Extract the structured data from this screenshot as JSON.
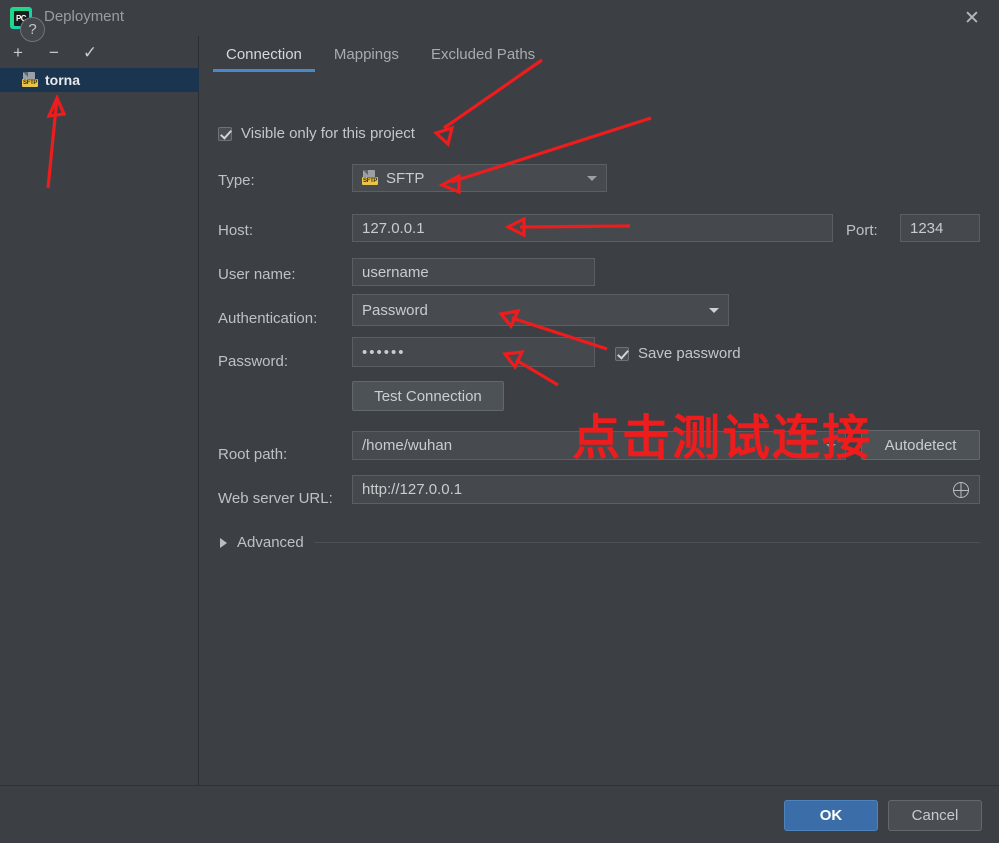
{
  "window": {
    "title": "Deployment",
    "logo_text": "PC",
    "close_label": "✕"
  },
  "sidebar": {
    "toolbar": [
      {
        "name": "add",
        "glyph": "+"
      },
      {
        "name": "remove",
        "glyph": "−"
      },
      {
        "name": "apply",
        "glyph": "✓"
      }
    ],
    "items": [
      {
        "label": "torna",
        "badge": "SFTP",
        "selected": true
      }
    ]
  },
  "tabs": [
    {
      "label": "Connection",
      "active": true
    },
    {
      "label": "Mappings",
      "active": false
    },
    {
      "label": "Excluded Paths",
      "active": false
    }
  ],
  "form": {
    "visible_only_label": "Visible only for this project",
    "type_label": "Type:",
    "type_value": "SFTP",
    "type_badge": "SFTP",
    "host_label": "Host:",
    "host_value": "127.0.0.1",
    "port_label": "Port:",
    "port_value": "1234",
    "username_label": "User name:",
    "username_value": "username",
    "auth_label": "Authentication:",
    "auth_value": "Password",
    "password_label": "Password:",
    "password_value": "••••••",
    "save_password_label": "Save password",
    "test_connection_label": "Test Connection",
    "root_path_label": "Root path:",
    "root_path_value": "/home/wuhan",
    "autodetect_label": "Autodetect",
    "web_url_label": "Web server URL:",
    "web_url_value": "http://127.0.0.1",
    "advanced_label": "Advanced"
  },
  "footer": {
    "help_label": "?",
    "ok_label": "OK",
    "cancel_label": "Cancel"
  },
  "annotation": {
    "note_text": "点击测试连接",
    "color": "#ee1c1c"
  },
  "colors": {
    "background": "#3c4044",
    "selection": "#1b3550",
    "accent": "#4a88c7",
    "field": "#45494d",
    "primary_button": "#3b6ea8"
  }
}
